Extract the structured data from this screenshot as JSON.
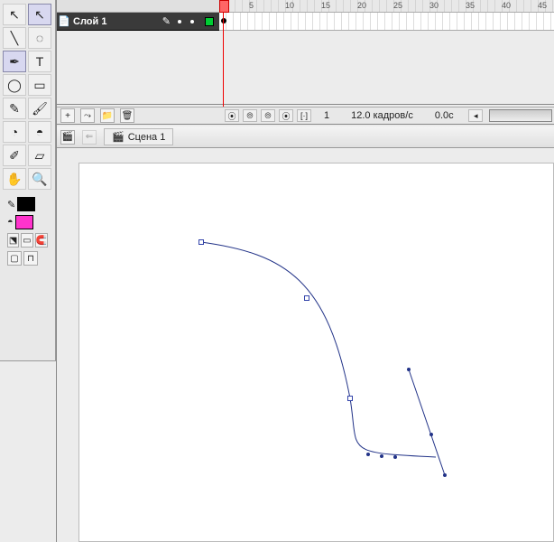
{
  "toolbox": {
    "tools": [
      {
        "name": "selection-tool",
        "glyph": "↖",
        "sel": false
      },
      {
        "name": "subselection-tool",
        "glyph": "↖",
        "sel": true
      },
      {
        "name": "line-tool",
        "glyph": "╲",
        "sel": false
      },
      {
        "name": "lasso-tool",
        "glyph": "◌",
        "sel": false
      },
      {
        "name": "pen-tool",
        "glyph": "✒",
        "sel": true
      },
      {
        "name": "text-tool",
        "glyph": "T",
        "sel": false
      },
      {
        "name": "oval-tool",
        "glyph": "◯",
        "sel": false
      },
      {
        "name": "rectangle-tool",
        "glyph": "▭",
        "sel": false
      },
      {
        "name": "pencil-tool",
        "glyph": "✎",
        "sel": false
      },
      {
        "name": "brush-tool",
        "glyph": "🖌",
        "sel": false
      },
      {
        "name": "ink-bottle-tool",
        "glyph": "◔",
        "sel": false
      },
      {
        "name": "paint-bucket-tool",
        "glyph": "◓",
        "sel": false
      },
      {
        "name": "eyedropper-tool",
        "glyph": "✐",
        "sel": false
      },
      {
        "name": "eraser-tool",
        "glyph": "▱",
        "sel": false
      },
      {
        "name": "hand-tool",
        "glyph": "✋",
        "sel": false
      },
      {
        "name": "zoom-tool",
        "glyph": "🔍",
        "sel": false
      }
    ],
    "stroke_sample": "✎",
    "stroke_color": "#000000",
    "fill_sample": "◓",
    "fill_color": "#ff33cc",
    "option_swap_glyph": "⬔",
    "option_none_glyph": "▭",
    "option_snap_glyph": "🧲",
    "option_rect": "▢",
    "option_magnet": "⊓"
  },
  "timeline": {
    "ruler_marks": [
      "5",
      "10",
      "15",
      "20",
      "25",
      "30",
      "35",
      "40",
      "45"
    ],
    "layer": {
      "icon": "📄",
      "name": "Слой 1",
      "pen_glyph": "✎",
      "outline_color": "#00cc33"
    }
  },
  "layer_footer": {
    "add_layer": "+",
    "add_motion": "⤳",
    "add_folder": "📁",
    "delete_layer": "🗑"
  },
  "status": {
    "btn_center": "⦿",
    "btn_onion1": "⦾",
    "btn_onion2": "⦾",
    "btn_onion3": "⦿",
    "btn_bracket": "[·]",
    "current_frame": "1",
    "fps": "12.0 кадров/с",
    "time": "0.0с",
    "scroll_left": "◂"
  },
  "scene_bar": {
    "edit_scene_glyph": "🎬",
    "back_glyph": "⇐",
    "scene_icon": "🎬",
    "scene_name": "Сцена 1"
  }
}
